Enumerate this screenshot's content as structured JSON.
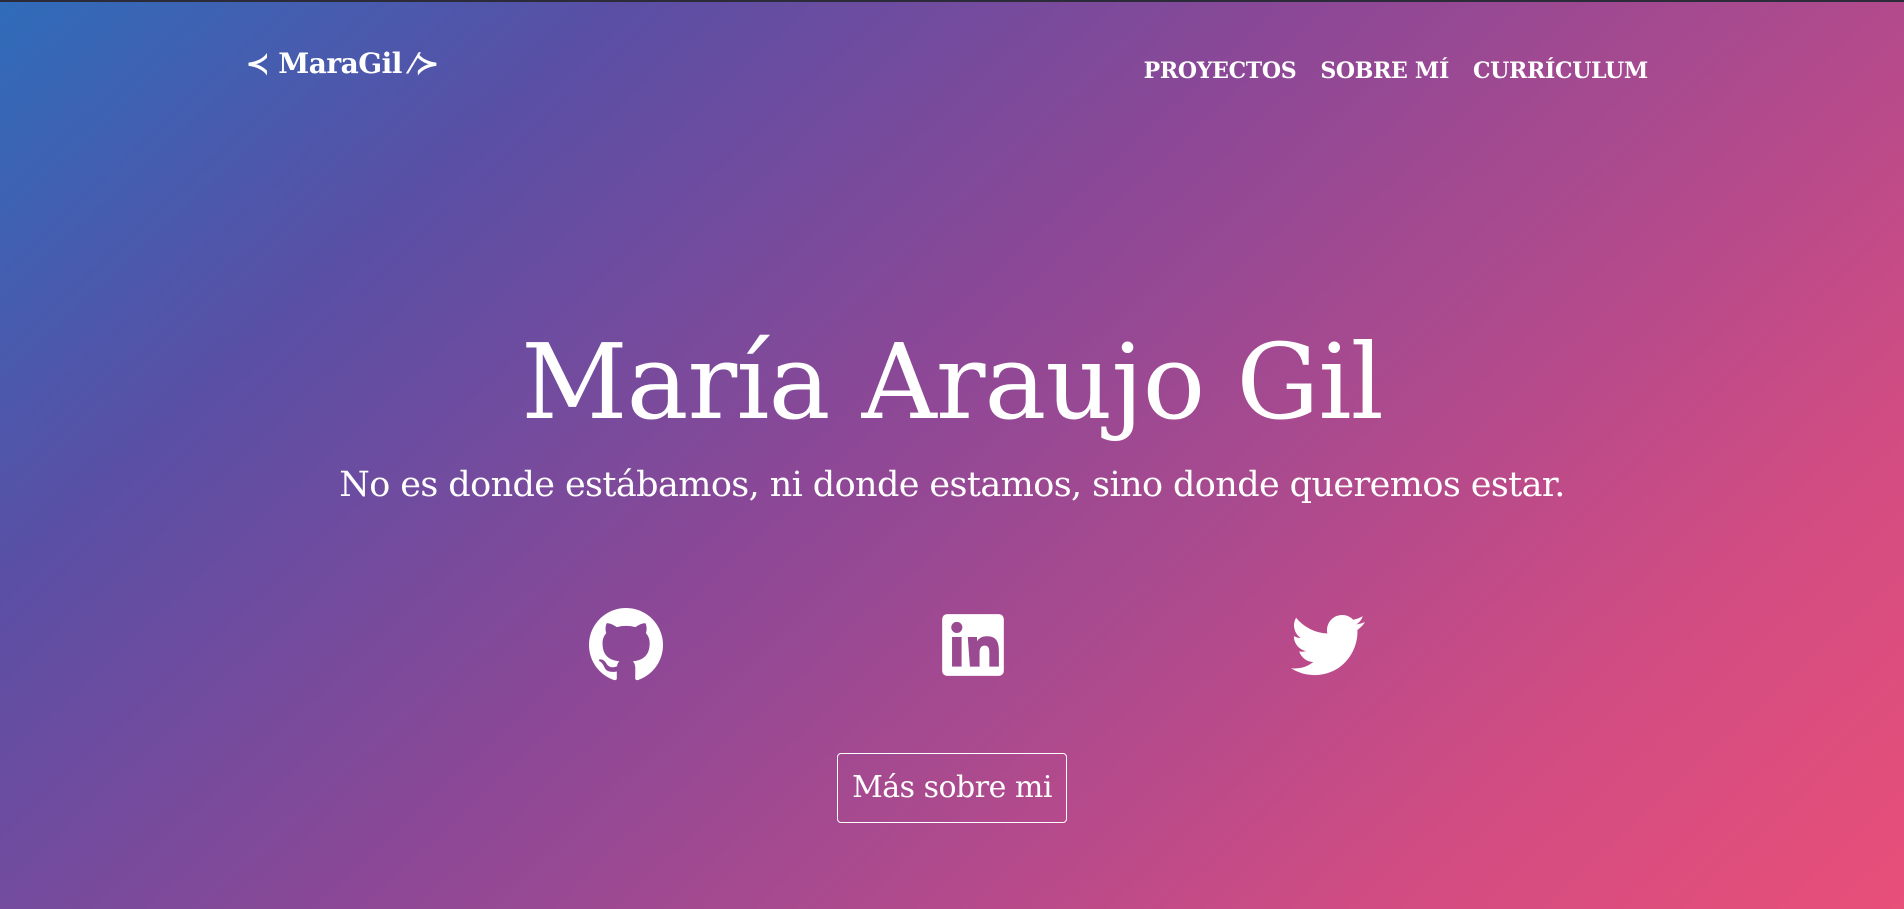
{
  "header": {
    "logo": "≺ MaraGil ⁄≻",
    "nav": [
      "PROYECTOS",
      "SOBRE MÍ",
      "CURRÍCULUM"
    ]
  },
  "hero": {
    "name": "María Araujo Gil",
    "tagline": "No es donde estábamos, ni donde estamos, sino donde queremos estar."
  },
  "social": [
    {
      "icon": "github-icon"
    },
    {
      "icon": "linkedin-icon"
    },
    {
      "icon": "twitter-icon"
    }
  ],
  "cta": {
    "label": "Más sobre mi"
  },
  "colors": {
    "gradient_start": "#2f6cba",
    "gradient_mid": "#8a4897",
    "gradient_end": "#e84f79",
    "text": "#ffffff"
  }
}
